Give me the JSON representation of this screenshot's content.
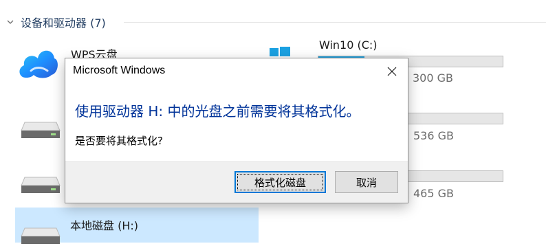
{
  "section": {
    "title": "设备和驱动器 (7)"
  },
  "drives": {
    "wps": {
      "name": "WPS云盘"
    },
    "c": {
      "name": "Win10 (C:)",
      "free": "300 GB",
      "used_fraction": 0.25
    },
    "d": {
      "free": "536 GB",
      "used_fraction": 0.0
    },
    "e": {
      "free": "465 GB",
      "used_fraction": 0.0
    },
    "h": {
      "name": "本地磁盘 (H:)"
    }
  },
  "dialog": {
    "title": "Microsoft Windows",
    "main_instruction": "使用驱动器 H: 中的光盘之前需要将其格式化。",
    "question": "是否要将其格式化?",
    "format_button": "格式化磁盘",
    "cancel_button": "取消"
  },
  "colors": {
    "accent": "#0078d7",
    "instruction": "#003399",
    "bar_fill": "#26a0da",
    "selection": "#cce8ff"
  }
}
